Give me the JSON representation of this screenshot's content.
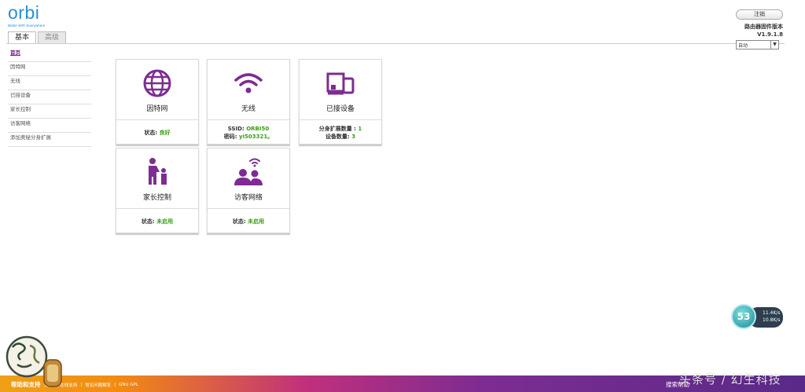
{
  "header": {
    "logo_text": "orbi",
    "logo_tagline": "Better WiFi Everywhere",
    "tabs": [
      {
        "label": "基本",
        "active": true
      },
      {
        "label": "高级",
        "active": false
      }
    ],
    "logout_label": "注销",
    "firmware_title": "路由器固件版本",
    "firmware_version": "V1.9.1.8",
    "language_selected": "自动"
  },
  "sidebar": {
    "items": [
      {
        "label": "首页",
        "active": true
      },
      {
        "label": "因特网"
      },
      {
        "label": "无线"
      },
      {
        "label": "已接设备"
      },
      {
        "label": "家长控制"
      },
      {
        "label": "访客网络"
      },
      {
        "label": "添加奥秘分身扩展"
      }
    ]
  },
  "cards": {
    "internet": {
      "title": "因特网",
      "status_label": "状态:",
      "status_value": "良好",
      "icon": "globe-icon"
    },
    "wireless": {
      "title": "无线",
      "ssid_label": "SSID:",
      "ssid_value": "ORBI50",
      "password_label": "密码:",
      "password_value": "yi503321。",
      "icon": "wifi-icon"
    },
    "devices": {
      "title": "已接设备",
      "satellite_label": "分身扩展数量 :",
      "satellite_value": "1",
      "device_label": "设备数量:",
      "device_value": "3",
      "icon": "devices-icon"
    },
    "parental": {
      "title": "家长控制",
      "status_label": "状态:",
      "status_value": "未启用",
      "icon": "parent-child-icon"
    },
    "guest": {
      "title": "访客网络",
      "status_label": "状态:",
      "status_value": "未启用",
      "icon": "guest-network-icon"
    }
  },
  "speed_widget": {
    "percent": "53",
    "upload": "11.4K/s",
    "download": "10.8K/s"
  },
  "footer": {
    "help_label": "帮助和支持",
    "links": [
      "文档",
      "在线支持",
      "常见问题解答",
      "GNU GPL"
    ],
    "search_label": "搜索帮助"
  },
  "watermark": "头条号 / 幻生科技",
  "colors": {
    "accent_purple": "#7d2c92",
    "status_green": "#3a9c14",
    "logo_blue": "#2a8fd8"
  }
}
